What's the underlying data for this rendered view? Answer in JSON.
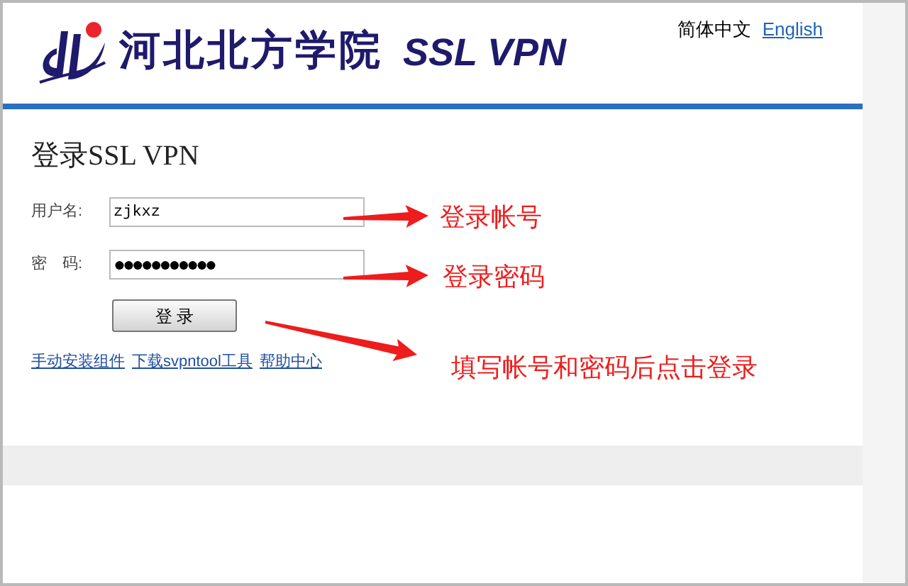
{
  "header": {
    "school_name": "河北北方学院",
    "product_name": "SSL VPN",
    "languages": [
      {
        "label": "简体中文",
        "selected": true
      },
      {
        "label": "English",
        "selected": false
      }
    ]
  },
  "login": {
    "title": "登录SSL VPN",
    "fields": [
      {
        "label": "用户名:",
        "value": "zjkxz",
        "kind": "text"
      },
      {
        "label": "密　码:",
        "value": "●●●●●●●●●●●",
        "kind": "password"
      }
    ],
    "submit": "登 录",
    "links": [
      "手动安装组件",
      "下载svpntool工具",
      "帮助中心"
    ]
  },
  "annotations": [
    "登录帐号",
    "登录密码",
    "填写帐号和密码后点击登录"
  ]
}
